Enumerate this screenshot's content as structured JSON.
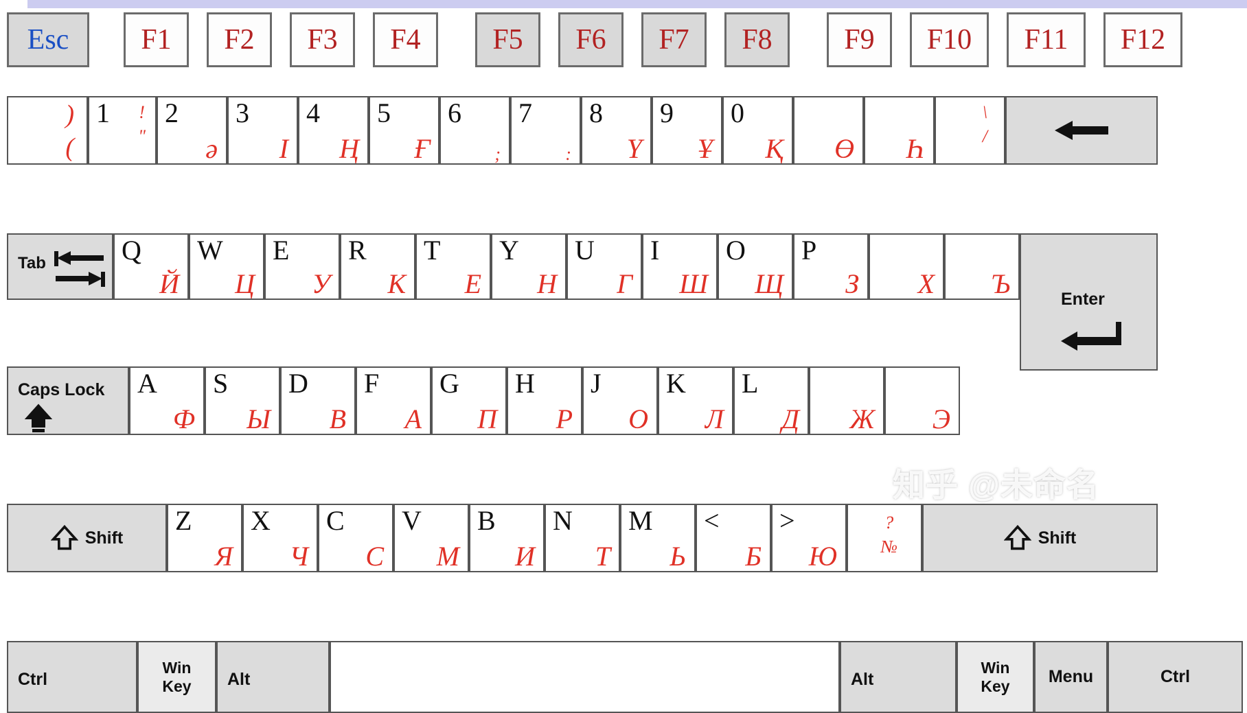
{
  "meta": {
    "layout_name": "Kazakh Cyrillic QWERTY keyboard layout",
    "accent_red": "#e03127",
    "esc_blue": "#1a4fc4",
    "fn_red": "#b22222",
    "key_gray": "#d9d9d9",
    "top_strip": "#ccccf0"
  },
  "function_row": {
    "esc": "Esc",
    "keys": [
      {
        "label": "F1",
        "shaded": false
      },
      {
        "label": "F2",
        "shaded": false
      },
      {
        "label": "F3",
        "shaded": false
      },
      {
        "label": "F4",
        "shaded": false
      },
      {
        "label": "F5",
        "shaded": true
      },
      {
        "label": "F6",
        "shaded": true
      },
      {
        "label": "F7",
        "shaded": true
      },
      {
        "label": "F8",
        "shaded": true
      },
      {
        "label": "F9",
        "shaded": false
      },
      {
        "label": "F10",
        "shaded": false
      },
      {
        "label": "F11",
        "shaded": false
      },
      {
        "label": "F12",
        "shaded": false
      }
    ]
  },
  "number_row": {
    "keys": [
      {
        "latin": "",
        "top": ")",
        "bottom": "("
      },
      {
        "latin": "1",
        "top": "!",
        "bottom": "\""
      },
      {
        "latin": "2",
        "cyr": "ә"
      },
      {
        "latin": "3",
        "cyr": "І"
      },
      {
        "latin": "4",
        "cyr": "Ң"
      },
      {
        "latin": "5",
        "cyr": "Ғ"
      },
      {
        "latin": "6",
        "cyr": ";"
      },
      {
        "latin": "7",
        "cyr": ":"
      },
      {
        "latin": "8",
        "cyr": "Ү"
      },
      {
        "latin": "9",
        "cyr": "Ұ"
      },
      {
        "latin": "0",
        "cyr": "Қ"
      },
      {
        "latin": "",
        "cyr": "Ө"
      },
      {
        "latin": "",
        "cyr": "Һ"
      },
      {
        "latin": "",
        "top": "\\",
        "bottom": "/"
      }
    ],
    "backspace": "backspace-arrow-icon"
  },
  "qwerty_row": {
    "tab": "Tab",
    "tab_icon": "tab-arrows-icon",
    "keys": [
      {
        "latin": "Q",
        "cyr": "Й"
      },
      {
        "latin": "W",
        "cyr": "Ц"
      },
      {
        "latin": "E",
        "cyr": "У"
      },
      {
        "latin": "R",
        "cyr": "К"
      },
      {
        "latin": "T",
        "cyr": "Е"
      },
      {
        "latin": "Y",
        "cyr": "Н"
      },
      {
        "latin": "U",
        "cyr": "Г"
      },
      {
        "latin": "I",
        "cyr": "Ш"
      },
      {
        "latin": "O",
        "cyr": "Щ"
      },
      {
        "latin": "P",
        "cyr": "З"
      },
      {
        "latin": "",
        "cyr": "Х"
      },
      {
        "latin": "",
        "cyr": "Ъ"
      }
    ],
    "enter": "Enter",
    "enter_icon": "enter-arrow-icon"
  },
  "home_row": {
    "caps_lock": "Caps Lock",
    "caps_icon": "caps-lock-arrow-icon",
    "keys": [
      {
        "latin": "A",
        "cyr": "Ф"
      },
      {
        "latin": "S",
        "cyr": "Ы"
      },
      {
        "latin": "D",
        "cyr": "В"
      },
      {
        "latin": "F",
        "cyr": "А"
      },
      {
        "latin": "G",
        "cyr": "П"
      },
      {
        "latin": "H",
        "cyr": "Р"
      },
      {
        "latin": "J",
        "cyr": "О"
      },
      {
        "latin": "K",
        "cyr": "Л"
      },
      {
        "latin": "L",
        "cyr": "Д"
      },
      {
        "latin": "",
        "cyr": "Ж"
      },
      {
        "latin": "",
        "cyr": "Э"
      }
    ]
  },
  "shift_row": {
    "shift_left": "Shift",
    "shift_right": "Shift",
    "shift_icon": "shift-arrow-icon",
    "keys": [
      {
        "latin": "Z",
        "cyr": "Я"
      },
      {
        "latin": "X",
        "cyr": "Ч"
      },
      {
        "latin": "C",
        "cyr": "С"
      },
      {
        "latin": "V",
        "cyr": "М"
      },
      {
        "latin": "B",
        "cyr": "И"
      },
      {
        "latin": "N",
        "cyr": "Т"
      },
      {
        "latin": "M",
        "cyr": "Ь"
      },
      {
        "latin": "<",
        "cyr": "Б"
      },
      {
        "latin": ">",
        "cyr": "Ю"
      },
      {
        "latin": "",
        "top": "?",
        "bottom": "№"
      }
    ]
  },
  "bottom_row": {
    "ctrl_left": "Ctrl",
    "win_left_line1": "Win",
    "win_left_line2": "Key",
    "alt_left": "Alt",
    "space": "",
    "alt_right": "Alt",
    "win_right_line1": "Win",
    "win_right_line2": "Key",
    "menu": "Menu",
    "ctrl_right": "Ctrl"
  },
  "watermark": {
    "text": "知乎 @未命名"
  }
}
